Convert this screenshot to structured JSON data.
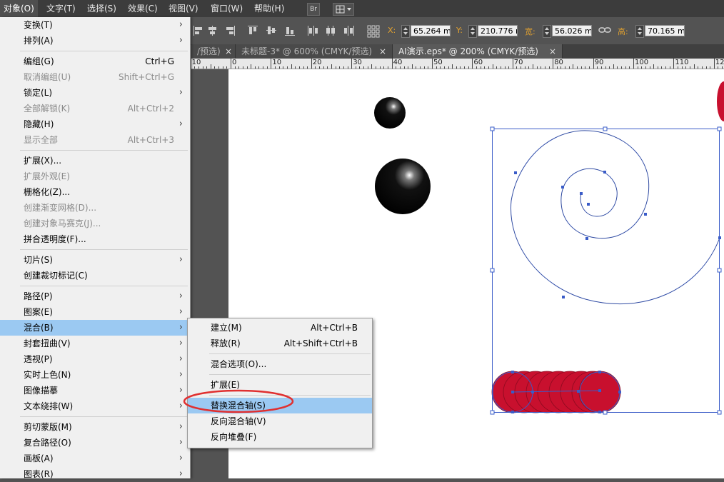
{
  "menubar": {
    "items": [
      "对象(O)",
      "文字(T)",
      "选择(S)",
      "效果(C)",
      "视图(V)",
      "窗口(W)",
      "帮助(H)"
    ],
    "bridge_label": "Br"
  },
  "control_bar": {
    "x": {
      "label": "X:",
      "value": "65.264 mi"
    },
    "y": {
      "label": "Y:",
      "value": "210.776 r"
    },
    "w": {
      "label": "宽:",
      "value": "56.026 mi"
    },
    "h": {
      "label": "高:",
      "value": "70.165 mi"
    }
  },
  "tabs": [
    {
      "label": "/预选)",
      "active": false
    },
    {
      "label": "未标题-3* @ 600% (CMYK/预选)",
      "active": false
    },
    {
      "label": "AI演示.eps* @ 200% (CMYK/预选)",
      "active": true
    }
  ],
  "ruler": {
    "labels": [
      "10",
      "0",
      "10",
      "20",
      "30",
      "40",
      "50",
      "60",
      "70",
      "80",
      "90",
      "100",
      "110",
      "12"
    ]
  },
  "object_menu": {
    "items": [
      {
        "label": "变换(T)",
        "shortcut": "",
        "submenu": true,
        "enabled": true
      },
      {
        "label": "排列(A)",
        "shortcut": "",
        "submenu": true,
        "enabled": true
      },
      {
        "separator": true
      },
      {
        "label": "编组(G)",
        "shortcut": "Ctrl+G",
        "submenu": false,
        "enabled": true
      },
      {
        "label": "取消编组(U)",
        "shortcut": "Shift+Ctrl+G",
        "submenu": false,
        "enabled": false
      },
      {
        "label": "锁定(L)",
        "shortcut": "",
        "submenu": true,
        "enabled": true
      },
      {
        "label": "全部解锁(K)",
        "shortcut": "Alt+Ctrl+2",
        "submenu": false,
        "enabled": false
      },
      {
        "label": "隐藏(H)",
        "shortcut": "",
        "submenu": true,
        "enabled": true
      },
      {
        "label": "显示全部",
        "shortcut": "Alt+Ctrl+3",
        "submenu": false,
        "enabled": false
      },
      {
        "separator": true
      },
      {
        "label": "扩展(X)...",
        "shortcut": "",
        "submenu": false,
        "enabled": true
      },
      {
        "label": "扩展外观(E)",
        "shortcut": "",
        "submenu": false,
        "enabled": false
      },
      {
        "label": "栅格化(Z)...",
        "shortcut": "",
        "submenu": false,
        "enabled": true
      },
      {
        "label": "创建渐变网格(D)...",
        "shortcut": "",
        "submenu": false,
        "enabled": false
      },
      {
        "label": "创建对象马赛克(J)...",
        "shortcut": "",
        "submenu": false,
        "enabled": false
      },
      {
        "label": "拼合透明度(F)...",
        "shortcut": "",
        "submenu": false,
        "enabled": true
      },
      {
        "separator": true
      },
      {
        "label": "切片(S)",
        "shortcut": "",
        "submenu": true,
        "enabled": true
      },
      {
        "label": "创建裁切标记(C)",
        "shortcut": "",
        "submenu": false,
        "enabled": true
      },
      {
        "separator": true
      },
      {
        "label": "路径(P)",
        "shortcut": "",
        "submenu": true,
        "enabled": true
      },
      {
        "label": "图案(E)",
        "shortcut": "",
        "submenu": true,
        "enabled": true
      },
      {
        "label": "混合(B)",
        "shortcut": "",
        "submenu": true,
        "enabled": true,
        "highlighted": true
      },
      {
        "label": "封套扭曲(V)",
        "shortcut": "",
        "submenu": true,
        "enabled": true
      },
      {
        "label": "透视(P)",
        "shortcut": "",
        "submenu": true,
        "enabled": true
      },
      {
        "label": "实时上色(N)",
        "shortcut": "",
        "submenu": true,
        "enabled": true
      },
      {
        "label": "图像描摹",
        "shortcut": "",
        "submenu": true,
        "enabled": true
      },
      {
        "label": "文本绕排(W)",
        "shortcut": "",
        "submenu": true,
        "enabled": true
      },
      {
        "separator": true
      },
      {
        "label": "剪切蒙版(M)",
        "shortcut": "",
        "submenu": true,
        "enabled": true
      },
      {
        "label": "复合路径(O)",
        "shortcut": "",
        "submenu": true,
        "enabled": true
      },
      {
        "label": "画板(A)",
        "shortcut": "",
        "submenu": true,
        "enabled": true
      },
      {
        "label": "图表(R)",
        "shortcut": "",
        "submenu": true,
        "enabled": true
      }
    ]
  },
  "blend_submenu": {
    "items": [
      {
        "label": "建立(M)",
        "shortcut": "Alt+Ctrl+B"
      },
      {
        "label": "释放(R)",
        "shortcut": "Alt+Shift+Ctrl+B"
      },
      {
        "separator": true
      },
      {
        "label": "混合选项(O)..."
      },
      {
        "separator": true
      },
      {
        "label": "扩展(E)"
      },
      {
        "separator": true
      },
      {
        "label": "替换混合轴(S)",
        "highlighted": true,
        "circled": true
      },
      {
        "label": "反向混合轴(V)"
      },
      {
        "label": "反向堆叠(F)"
      }
    ]
  },
  "colors": {
    "menu_highlight": "#9bc9f2",
    "annotation_red": "#e03030",
    "blend_red": "#c8102e",
    "path_blue": "#3a5cc8"
  }
}
